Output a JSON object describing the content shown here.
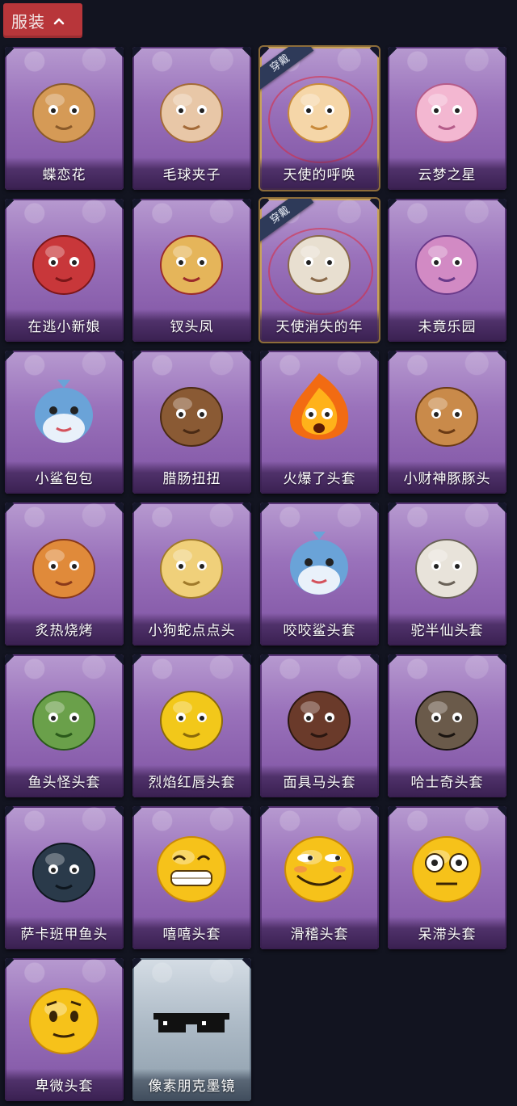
{
  "section": {
    "title": "服装"
  },
  "badge_text": "穿戴",
  "items": [
    {
      "name": "蝶恋花",
      "icon": "butterfly-flower-ornament"
    },
    {
      "name": "毛球夹子",
      "icon": "raccoon-drummer"
    },
    {
      "name": "天使的呼唤",
      "icon": "angel-cherub",
      "worn": true
    },
    {
      "name": "云梦之星",
      "icon": "unicorn-on-cloud"
    },
    {
      "name": "在逃小新娘",
      "icon": "red-lamp-dress"
    },
    {
      "name": "钗头凤",
      "icon": "phoenix-crown-doll"
    },
    {
      "name": "天使消失的年",
      "icon": "veiled-angel-doll",
      "worn": true
    },
    {
      "name": "未竟乐园",
      "icon": "magical-girl-doll"
    },
    {
      "name": "小鲨包包",
      "icon": "shark-bag"
    },
    {
      "name": "腊肠扭扭",
      "icon": "dachshund-head"
    },
    {
      "name": "火爆了头套",
      "icon": "fire-spirit-head"
    },
    {
      "name": "小财神豚豚头",
      "icon": "capybara-god-of-wealth"
    },
    {
      "name": "炙热烧烤",
      "icon": "bbq-meat-head"
    },
    {
      "name": "小狗蛇点点头",
      "icon": "dog-snake-head"
    },
    {
      "name": "咬咬鲨头套",
      "icon": "shark-head"
    },
    {
      "name": "驼半仙头套",
      "icon": "sunglasses-bear-head"
    },
    {
      "name": "鱼头怪头套",
      "icon": "fish-monster-head"
    },
    {
      "name": "烈焰红唇头套",
      "icon": "pikachu-lips-head"
    },
    {
      "name": "面具马头套",
      "icon": "horse-mask-head"
    },
    {
      "name": "哈士奇头套",
      "icon": "husky-head"
    },
    {
      "name": "萨卡班甲鱼头",
      "icon": "sacabambaspis-head"
    },
    {
      "name": "嘻嘻头套",
      "icon": "grin-emoji-head"
    },
    {
      "name": "滑稽头套",
      "icon": "funny-emoji-head"
    },
    {
      "name": "呆滞头套",
      "icon": "dazed-emoji-head"
    },
    {
      "name": "卑微头套",
      "icon": "humble-emoji-head"
    },
    {
      "name": "像素朋克墨镜",
      "icon": "pixel-sunglasses",
      "gray": true
    }
  ]
}
